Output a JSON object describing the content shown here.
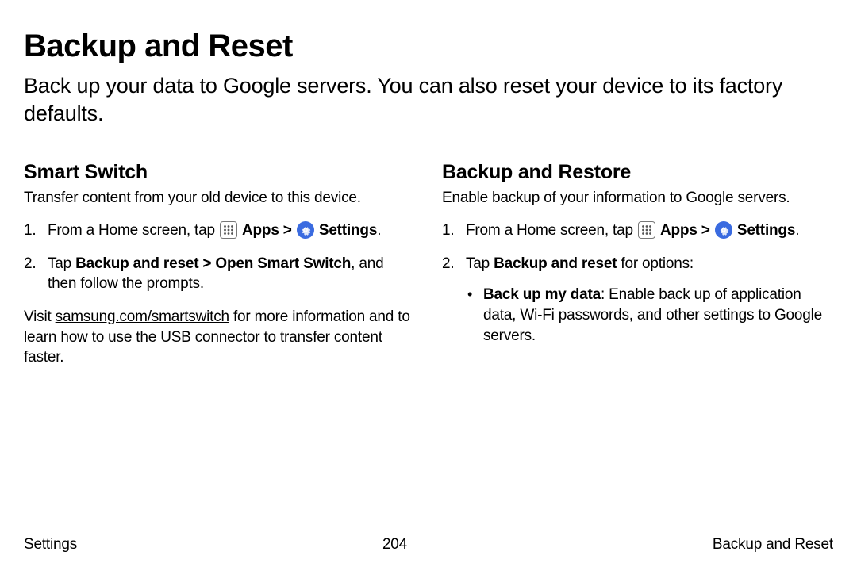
{
  "page": {
    "title": "Backup and Reset",
    "intro": "Back up your data to Google servers. You can also reset your device to its factory defaults."
  },
  "left": {
    "heading": "Smart Switch",
    "desc": "Transfer content from your old device to this device.",
    "step1_a": "From a Home screen, tap ",
    "apps_label": "Apps",
    "chev": " > ",
    "settings_label": "Settings",
    "step1_end": ".",
    "step2_a": "Tap ",
    "step2_bold": "Backup and reset > Open Smart Switch",
    "step2_b": ", and then follow the prompts.",
    "after_a": "Visit ",
    "after_link": "samsung.com/smartswitch",
    "after_b": " for more information and to learn how to use the USB connector to transfer content faster."
  },
  "right": {
    "heading": "Backup and Restore",
    "desc": "Enable backup of your information to Google servers.",
    "step1_a": "From a Home screen, tap ",
    "apps_label": "Apps",
    "chev": " > ",
    "settings_label": "Settings",
    "step1_end": ".",
    "step2_a": "Tap ",
    "step2_bold": "Backup and reset",
    "step2_b": " for options:",
    "bullet1_bold": "Back up my data",
    "bullet1_rest": ": Enable back up of application data, Wi-Fi passwords, and other settings to Google servers."
  },
  "footer": {
    "left": "Settings",
    "center": "204",
    "right": "Backup and Reset"
  }
}
